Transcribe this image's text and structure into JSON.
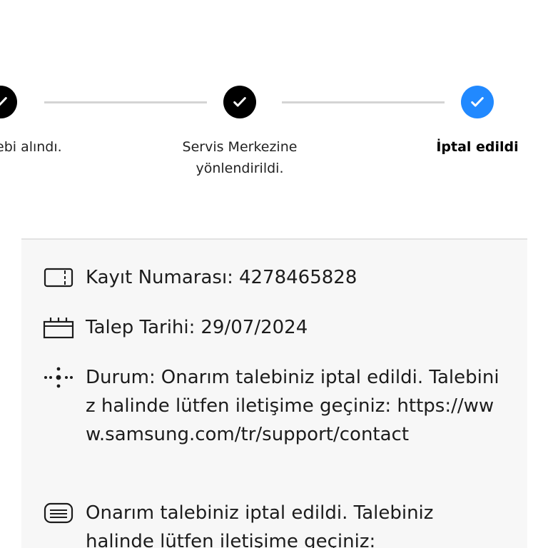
{
  "stepper": {
    "steps": [
      {
        "label": "ebi alındı.",
        "status": "done"
      },
      {
        "label_line1": "Servis Merkezine",
        "label_line2": "yönlendirildi.",
        "status": "done"
      },
      {
        "label": "İptal edildi",
        "status": "current"
      }
    ],
    "colors": {
      "done": "#000000",
      "current": "#2189ff",
      "connector": "#d4d4d4"
    }
  },
  "details": {
    "record_label": "Kayıt Numarası:",
    "record_value": "4278465828",
    "date_label": "Talep Tarihi:",
    "date_value": "29/07/2024",
    "status_label": "Durum:",
    "status_value": "Onarım talebiniz iptal edildi. Talebiniz halinde lütfen iletişime geçiniz: https://www.samsung.com/tr/support/contact",
    "note_text": "Onarım talebiniz iptal edildi. Talebiniz halinde lütfen iletişime geçiniz:",
    "icons": [
      "ticket-icon",
      "calendar-icon",
      "status-dots-icon",
      "message-icon"
    ]
  }
}
